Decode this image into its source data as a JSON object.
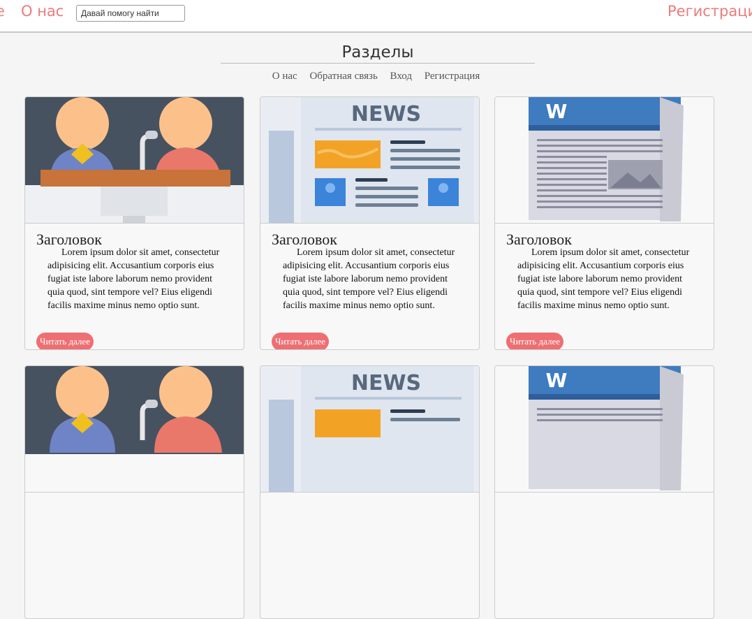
{
  "header": {
    "nav_cut_label": "е",
    "about_label": "О нас",
    "search_placeholder": "Давай помогу найти",
    "register_label": "Регистрация"
  },
  "sections": {
    "title": "Разделы",
    "links": [
      "О нас",
      "Обратная связь",
      "Вход",
      "Регистрация"
    ]
  },
  "cards": [
    {
      "image": "conference-illustration",
      "title": "Заголовок",
      "text": "Lorem ipsum dolor sit amet, consectetur adipisicing elit. Accusantium corporis eius fugiat iste labore laborum nemo provident quia quod, sint tempore vel? Eius eligendi facilis maxime minus nemo optio sunt.",
      "button": "Читать далее"
    },
    {
      "image": "newspaper-illustration",
      "title": "Заголовок",
      "text": "Lorem ipsum dolor sit amet, consectetur adipisicing elit. Accusantium corporis eius fugiat iste labore laborum nemo provident quia quod, sint tempore vel? Eius eligendi facilis maxime minus nemo optio sunt.",
      "button": "Читать далее"
    },
    {
      "image": "word-document-illustration",
      "title": "Заголовок",
      "text": "Lorem ipsum dolor sit amet, consectetur adipisicing elit. Accusantium corporis eius fugiat iste labore laborum nemo provident quia quod, sint tempore vel? Eius eligendi facilis maxime minus nemo optio sunt.",
      "button": "Читать далее"
    },
    {
      "image": "conference-illustration"
    },
    {
      "image": "newspaper-illustration"
    },
    {
      "image": "word-document-illustration"
    }
  ],
  "illustration_text": {
    "news": "NEWS",
    "word": "W"
  },
  "colors": {
    "accent": "#ee7b7b",
    "button": "#ee6f73"
  }
}
